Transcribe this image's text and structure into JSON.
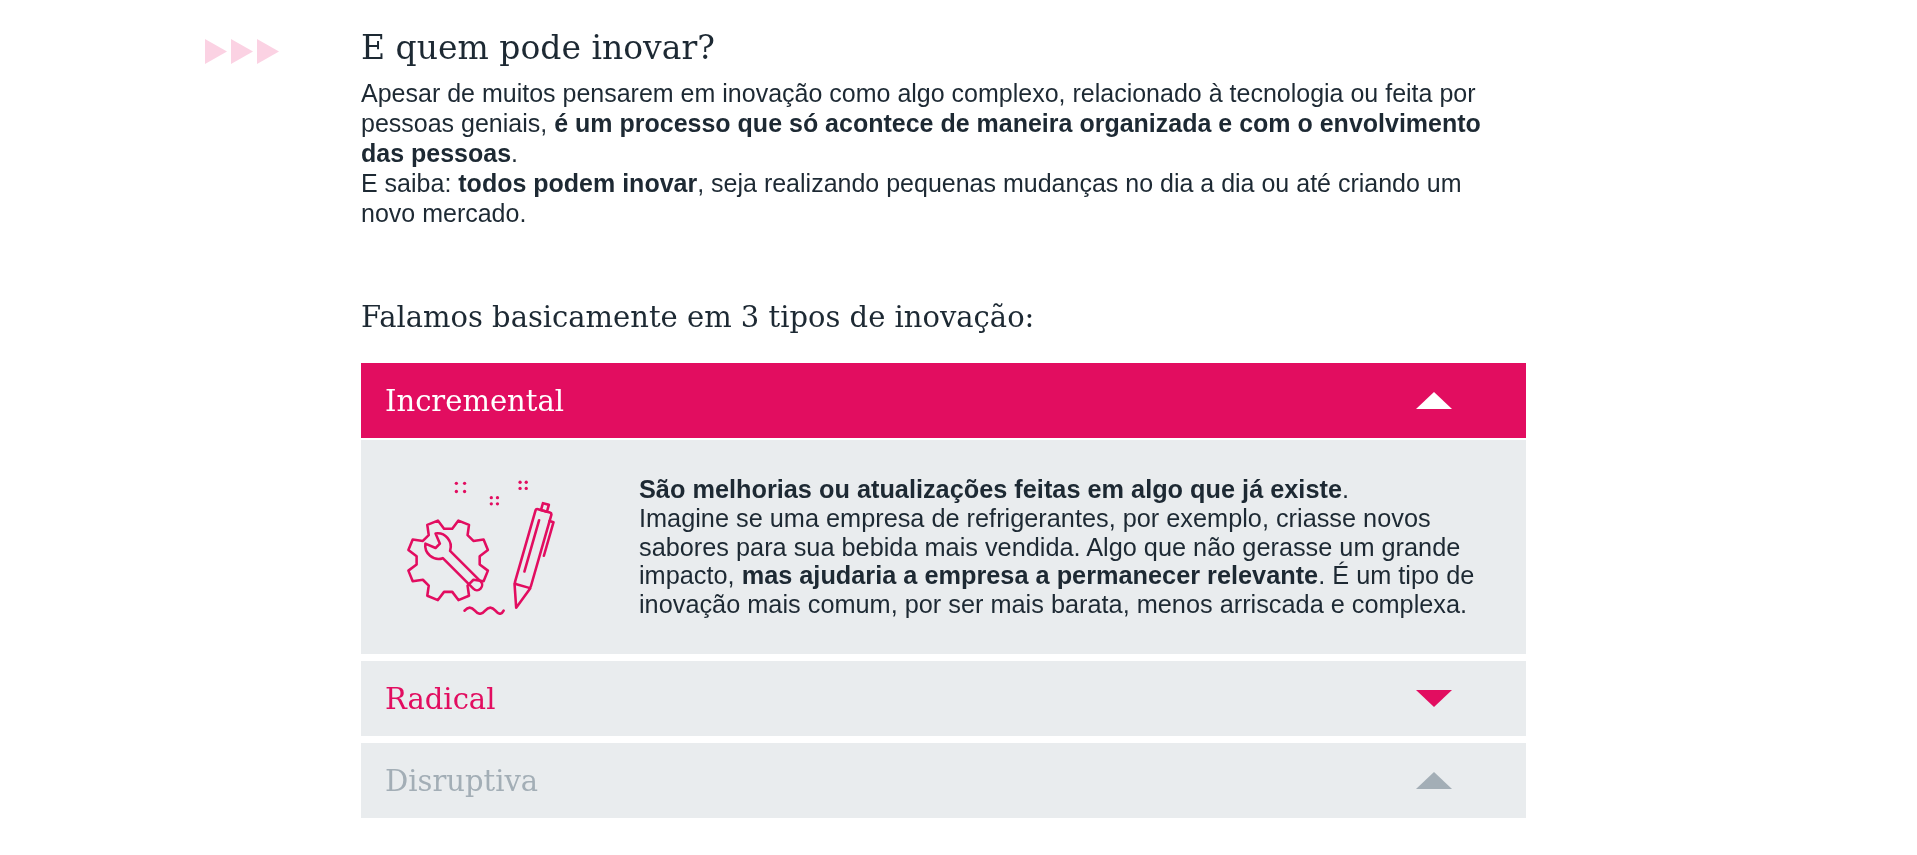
{
  "section": {
    "title": "E quem pode inovar?",
    "paragraphs": [
      "Apesar de muitos pensarem em inovação como algo complexo, relacionado à tecnologia ou feita por pessoas geniais, **é um processo que só acontece de maneira organizada e com o envolvimento das pessoas**.",
      "E saiba: **todos podem inovar**, seja realizando pequenas mudanças no dia a dia ou até criando um novo mercado."
    ]
  },
  "types_heading": "Falamos basicamente em 3 tipos de inovação:",
  "accordion": {
    "items": [
      {
        "title": "Incremental",
        "expanded": true,
        "disabled": false,
        "paragraphs": [
          "**São melhorias ou atualizações feitas em algo que já existe**.",
          "Imagine se uma empresa de refrigerantes, por exemplo, criasse novos sabores para sua bebida mais vendida. Algo que não gerasse um grande impacto, **mas ajudaria a empresa a permanecer relevante**. É um tipo de inovação mais comum, por ser mais barata, menos arriscada e complexa."
        ]
      },
      {
        "title": "Radical",
        "expanded": false,
        "disabled": false
      },
      {
        "title": "Disruptiva",
        "expanded": false,
        "disabled": true
      }
    ]
  }
}
